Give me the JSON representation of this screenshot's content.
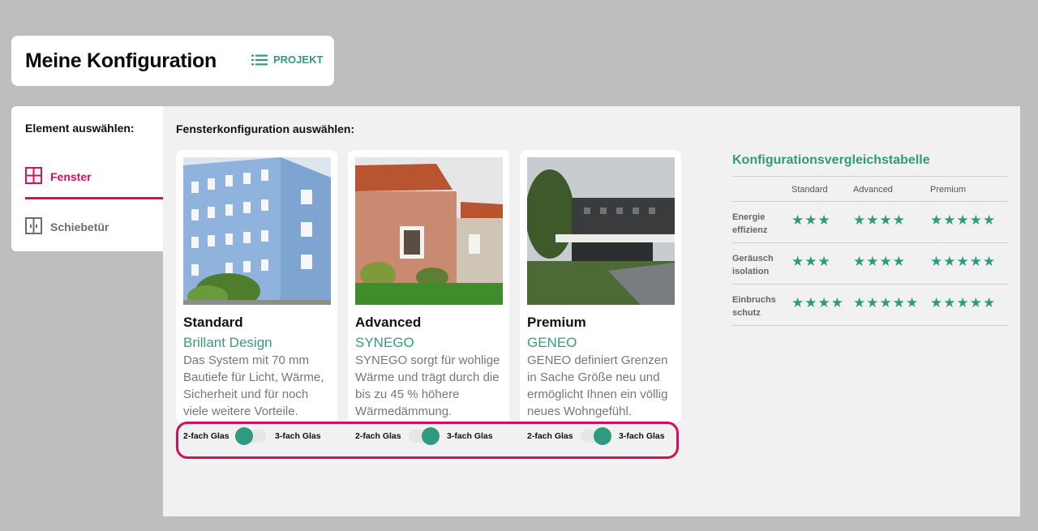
{
  "header": {
    "title": "Meine Konfiguration",
    "projekt_label": "PROJEKT"
  },
  "sidebar": {
    "title": "Element auswählen:",
    "items": [
      {
        "label": "Fenster",
        "icon": "window-icon",
        "active": true
      },
      {
        "label": "Schiebetür",
        "icon": "sliding-door-icon",
        "active": false
      }
    ]
  },
  "main": {
    "title": "Fensterkonfiguration auswählen:",
    "cards": [
      {
        "name": "Standard",
        "product": "Brillant Design",
        "description": "Das System mit 70 mm Bautiefe für Licht, Wärme, Sicherheit und für noch viele weitere Vorteile.",
        "glass_left": "2-fach Glas",
        "glass_right": "3-fach Glas",
        "glass_selected": "2-fach Glas"
      },
      {
        "name": "Advanced",
        "product": "SYNEGO",
        "description": "SYNEGO sorgt für wohlige Wärme und trägt durch die bis zu 45 % höhere Wärmedämmung.",
        "glass_left": "2-fach Glas",
        "glass_right": "3-fach Glas",
        "glass_selected": "3-fach Glas"
      },
      {
        "name": "Premium",
        "product": "GENEO",
        "description": "GENEO definiert Grenzen in Sache Größe neu und ermöglicht Ihnen ein völlig neues Wohngefühl.",
        "glass_left": "2-fach Glas",
        "glass_right": "3-fach Glas",
        "glass_selected": "3-fach Glas"
      }
    ]
  },
  "comparison": {
    "title": "Konfigurationsvergleichstabelle",
    "columns": [
      "Standard",
      "Advanced",
      "Premium"
    ],
    "rows": [
      {
        "label": "Energie effizienz",
        "ratings": [
          3,
          4,
          5
        ]
      },
      {
        "label": "Geräusch isolation",
        "ratings": [
          3,
          4,
          5
        ]
      },
      {
        "label": "Einbruchs schutz",
        "ratings": [
          4,
          5,
          5
        ]
      }
    ]
  },
  "colors": {
    "accent": "#2f9a7f",
    "brand_pink": "#d6105e",
    "panel_bg": "#f1f1f1",
    "page_bg": "#bebebe"
  }
}
